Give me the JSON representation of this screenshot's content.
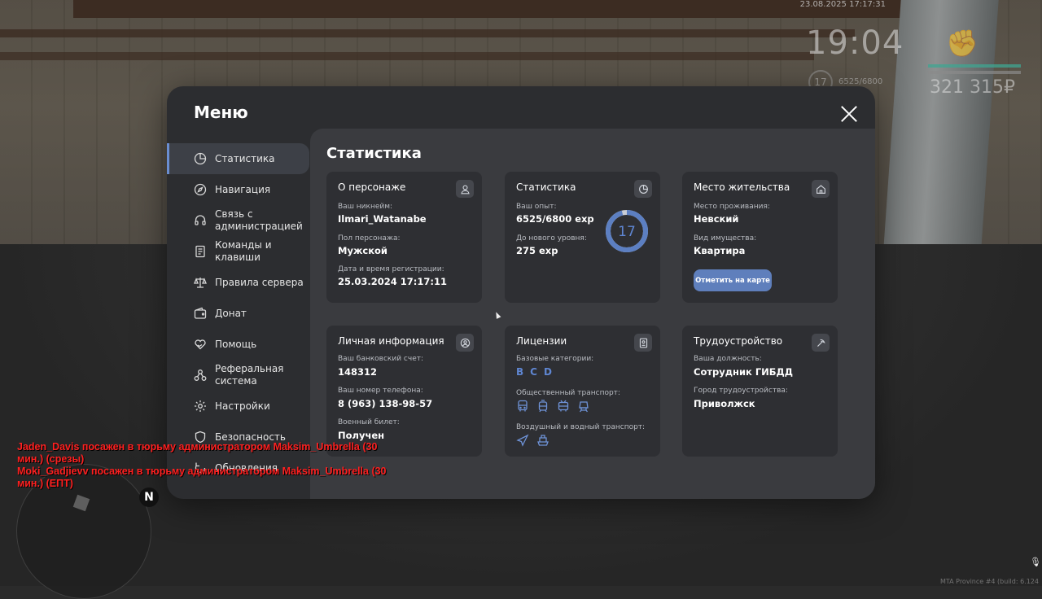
{
  "hud": {
    "datetime": "23.08.2025 17:17:31",
    "time": "19:04",
    "money": "321 315₽",
    "level": "17",
    "exp": "6525/6800",
    "fist_icon": "fist-icon"
  },
  "menu": {
    "title": "Меню",
    "sidebar": [
      {
        "label": "Статистика",
        "icon": "pie-chart-icon",
        "active": true
      },
      {
        "label": "Навигация",
        "icon": "compass-icon"
      },
      {
        "label": "Связь с администрацией",
        "icon": "headset-icon"
      },
      {
        "label": "Команды и клавиши",
        "icon": "document-icon"
      },
      {
        "label": "Правила сервера",
        "icon": "scales-icon"
      },
      {
        "label": "Донат",
        "icon": "wallet-icon"
      },
      {
        "label": "Помощь",
        "icon": "heart-hand-icon"
      },
      {
        "label": "Реферальная система",
        "icon": "network-icon"
      },
      {
        "label": "Настройки",
        "icon": "gear-icon"
      },
      {
        "label": "Безопасность",
        "icon": "shield-icon"
      },
      {
        "label": "Обновления",
        "icon": "refresh-icon"
      }
    ],
    "content_title": "Статистика",
    "cards": {
      "character": {
        "title": "О персонаже",
        "nick_label": "Ваш никнейм:",
        "nick": "Ilmari_Watanabe",
        "gender_label": "Пол персонажа:",
        "gender": "Мужской",
        "reg_label": "Дата и время регистрации:",
        "reg": "25.03.2024 17:17:11"
      },
      "stats": {
        "title": "Статистика",
        "exp_label": "Ваш опыт:",
        "exp": "6525/6800 exp",
        "next_label": "До нового уровня:",
        "next": "275 exp",
        "level": "17",
        "progress": 0.96
      },
      "residence": {
        "title": "Место жительства",
        "place_label": "Место проживания:",
        "place": "Невский",
        "type_label": "Вид имущества:",
        "type": "Квартира",
        "map_button": "Отметить на карте"
      },
      "personal": {
        "title": "Личная информация",
        "bank_label": "Ваш банковский счет:",
        "bank": "148312",
        "phone_label": "Ваш номер телефона:",
        "phone": "8 (963) 138-98-57",
        "military_label": "Военный билет:",
        "military": "Получен"
      },
      "licenses": {
        "title": "Лицензии",
        "base_label": "Базовые категории:",
        "categories": [
          "B",
          "C",
          "D"
        ],
        "public_label": "Общественный транспорт:",
        "air_label": "Воздушный и водный транспорт:"
      },
      "job": {
        "title": "Трудоустройство",
        "position_label": "Ваша должность:",
        "position": "Сотрудник ГИБДД",
        "city_label": "Город трудоустройства:",
        "city": "Приволжск"
      }
    }
  },
  "chat": [
    "Jaden_Davis посажен в тюрьму администратором Maksim_Umbrella (30 мин.) (срезы)",
    "Moki_Gadjievv посажен в тюрьму администратором Maksim_Umbrella (30 мин.) (ЕПТ)"
  ],
  "minimap": {
    "north": "N"
  },
  "version": "MTA Province #4 (build: 6.124"
}
